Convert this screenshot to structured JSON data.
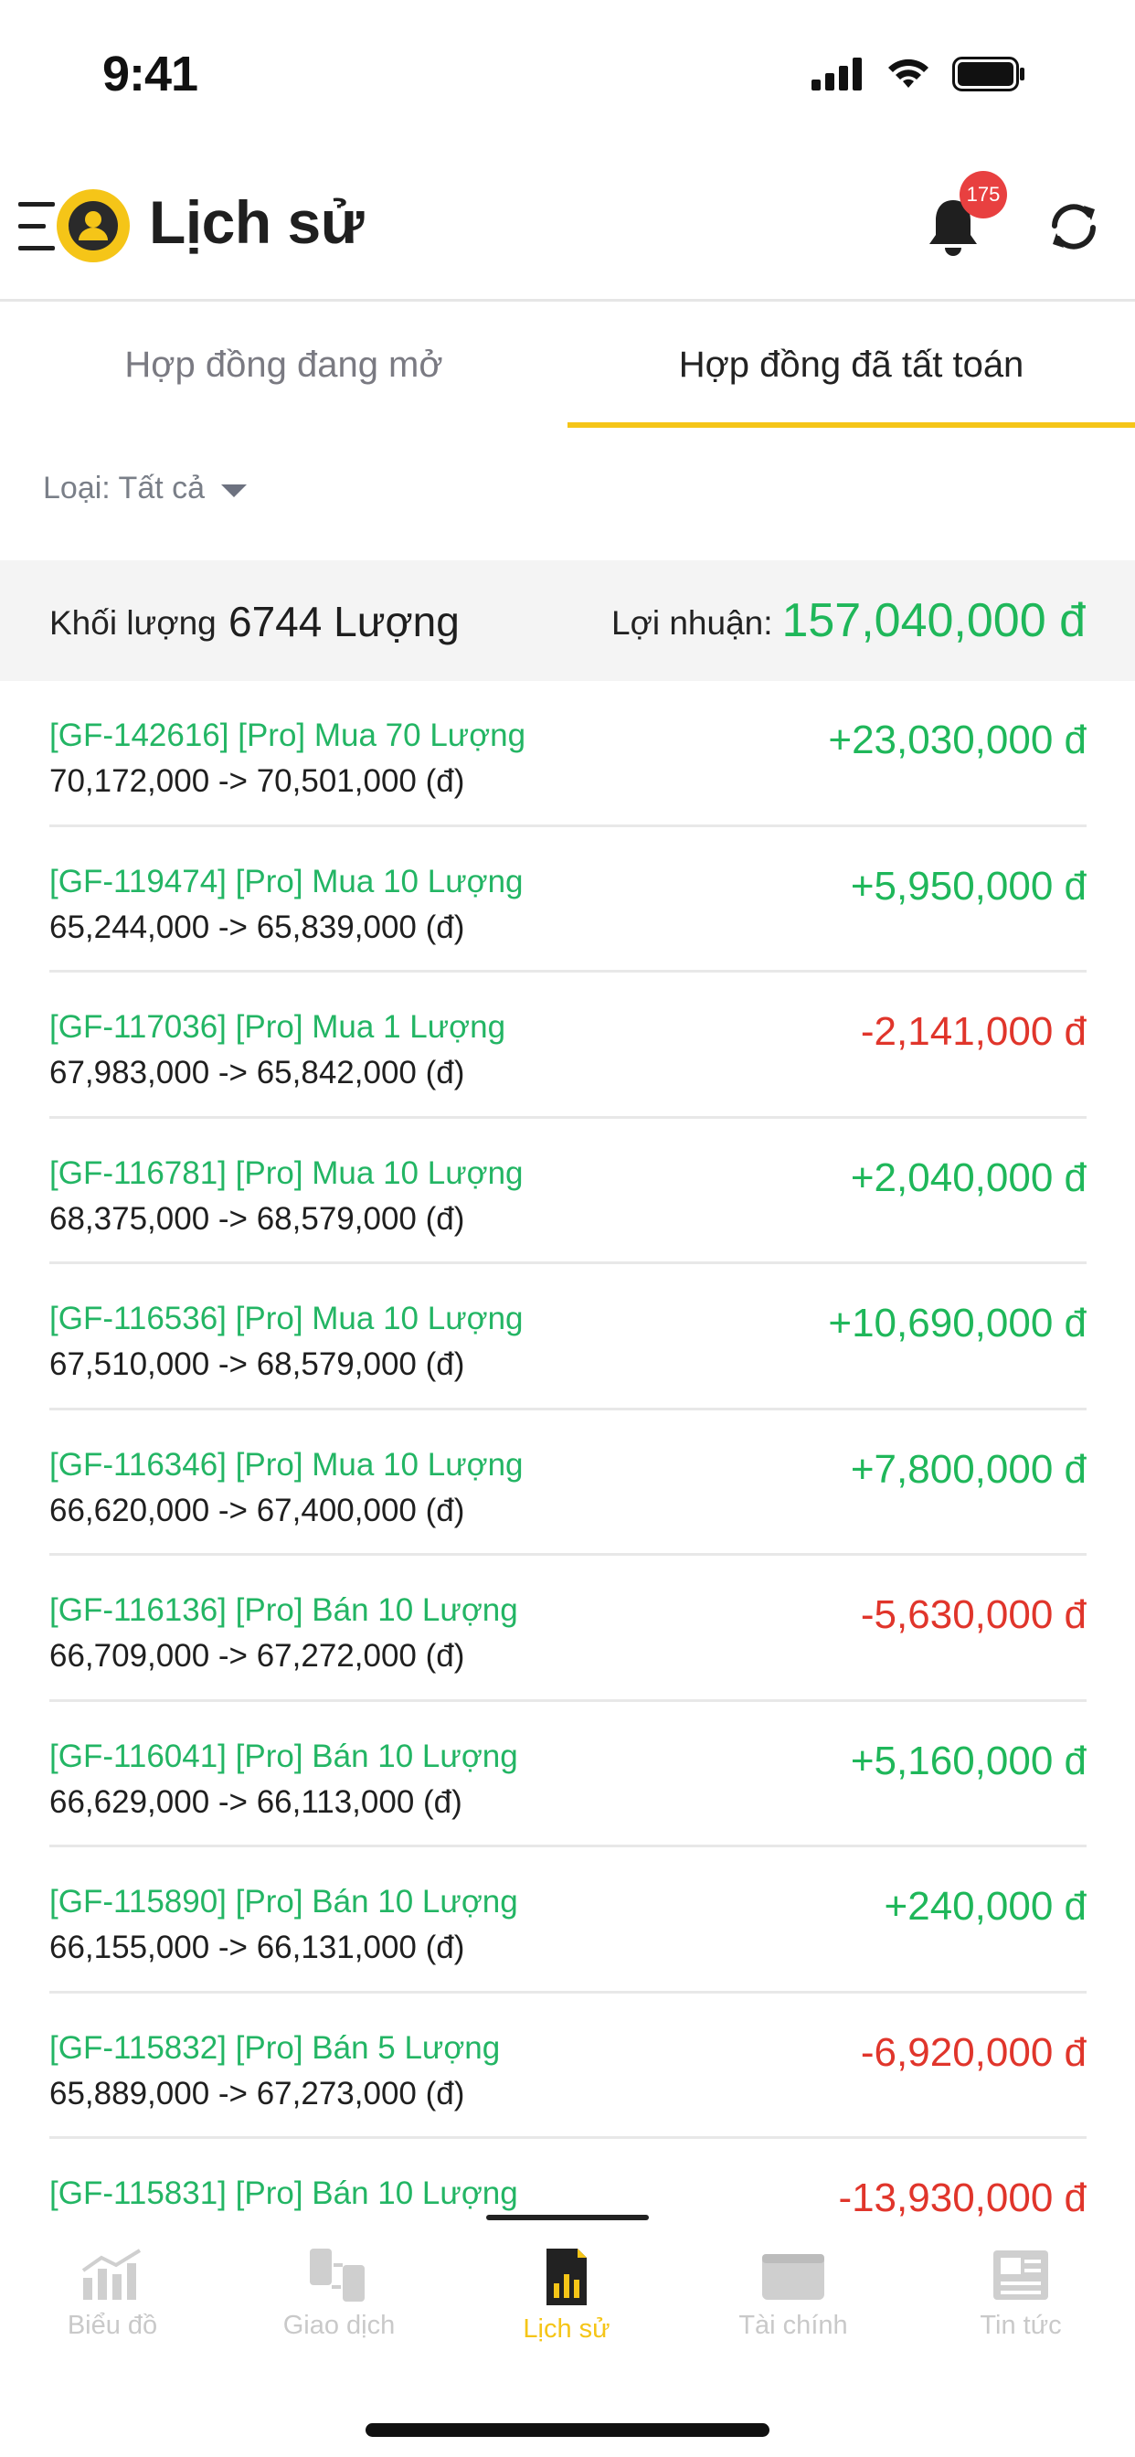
{
  "status_bar": {
    "time": "9:41"
  },
  "header": {
    "title": "Lịch sử",
    "notification_count": "175"
  },
  "tabs": [
    {
      "label": "Hợp đồng đang mở",
      "active": false
    },
    {
      "label": "Hợp đồng đã tất toán",
      "active": true
    }
  ],
  "filter": {
    "label": "Loại: Tất cả"
  },
  "summary": {
    "volume_label": "Khối lượng",
    "volume_value": "6744 Lượng",
    "profit_label": "Lợi nhuận:",
    "profit_value": "157,040,000 đ"
  },
  "contracts": [
    {
      "title": "[GF-142616] [Pro] Mua 70 Lượng",
      "prices": "70,172,000 -> 70,501,000 (đ)",
      "pl": "+23,030,000 đ",
      "sign": "pos"
    },
    {
      "title": "[GF-119474] [Pro] Mua 10 Lượng",
      "prices": "65,244,000 -> 65,839,000 (đ)",
      "pl": "+5,950,000 đ",
      "sign": "pos"
    },
    {
      "title": "[GF-117036] [Pro] Mua 1 Lượng",
      "prices": "67,983,000 -> 65,842,000 (đ)",
      "pl": "-2,141,000 đ",
      "sign": "neg"
    },
    {
      "title": "[GF-116781] [Pro] Mua 10 Lượng",
      "prices": "68,375,000 -> 68,579,000 (đ)",
      "pl": "+2,040,000 đ",
      "sign": "pos"
    },
    {
      "title": "[GF-116536] [Pro] Mua 10 Lượng",
      "prices": "67,510,000 -> 68,579,000 (đ)",
      "pl": "+10,690,000 đ",
      "sign": "pos"
    },
    {
      "title": "[GF-116346] [Pro] Mua 10 Lượng",
      "prices": "66,620,000 -> 67,400,000 (đ)",
      "pl": "+7,800,000 đ",
      "sign": "pos"
    },
    {
      "title": "[GF-116136] [Pro] Bán 10 Lượng",
      "prices": "66,709,000 -> 67,272,000 (đ)",
      "pl": "-5,630,000 đ",
      "sign": "neg"
    },
    {
      "title": "[GF-116041] [Pro] Bán 10 Lượng",
      "prices": "66,629,000 -> 66,113,000 (đ)",
      "pl": "+5,160,000 đ",
      "sign": "pos"
    },
    {
      "title": "[GF-115890] [Pro] Bán 10 Lượng",
      "prices": "66,155,000 -> 66,131,000 (đ)",
      "pl": "+240,000 đ",
      "sign": "pos"
    },
    {
      "title": "[GF-115832] [Pro] Bán 5 Lượng",
      "prices": "65,889,000 -> 67,273,000 (đ)",
      "pl": "-6,920,000 đ",
      "sign": "neg"
    },
    {
      "title": "[GF-115831] [Pro] Bán 10 Lượng",
      "prices": "",
      "pl": "-13,930,000 đ",
      "sign": "neg"
    }
  ],
  "bottom_nav": [
    {
      "label": "Biểu đồ",
      "icon": "chart-icon",
      "active": false
    },
    {
      "label": "Giao dịch",
      "icon": "exchange-icon",
      "active": false
    },
    {
      "label": "Lịch sử",
      "icon": "history-icon",
      "active": true
    },
    {
      "label": "Tài chính",
      "icon": "wallet-icon",
      "active": false
    },
    {
      "label": "Tin tức",
      "icon": "news-icon",
      "active": false
    }
  ],
  "colors": {
    "accent": "#f5c518",
    "positive": "#1fb75a",
    "negative": "#e0352b"
  }
}
